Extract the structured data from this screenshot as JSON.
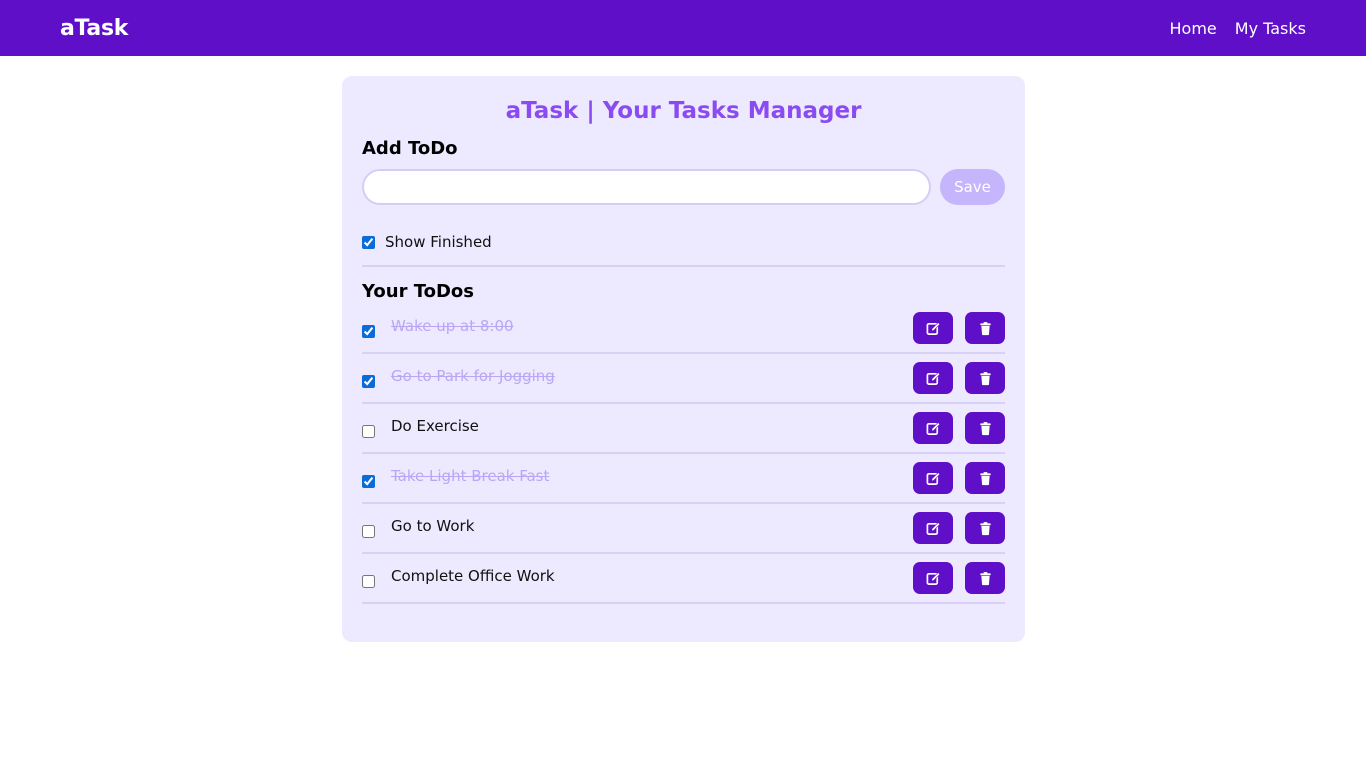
{
  "navbar": {
    "brand": "aTask",
    "links": [
      "Home",
      "My Tasks"
    ]
  },
  "card": {
    "heading": "aTask | Your Tasks Manager",
    "add_title": "Add ToDo",
    "input_value": "",
    "save_label": "Save",
    "show_finished_label": "Show Finished",
    "show_finished_checked": true,
    "todos_title": "Your ToDos"
  },
  "todos": [
    {
      "text": "Wake up at 8:00",
      "done": true
    },
    {
      "text": "Go to Park for Jogging",
      "done": true
    },
    {
      "text": "Do Exercise",
      "done": false
    },
    {
      "text": "Take Light Break Fast",
      "done": true
    },
    {
      "text": "Go to Work",
      "done": false
    },
    {
      "text": "Complete Office Work",
      "done": false
    }
  ],
  "icons": {
    "edit": "edit-icon",
    "delete": "trash-icon"
  },
  "colors": {
    "nav_bg": "#5f0fc8",
    "card_bg": "#ede9fe",
    "heading": "#8a4cf0",
    "save_btn": "#c4b5fd",
    "done_text": "#b9a7f6"
  }
}
